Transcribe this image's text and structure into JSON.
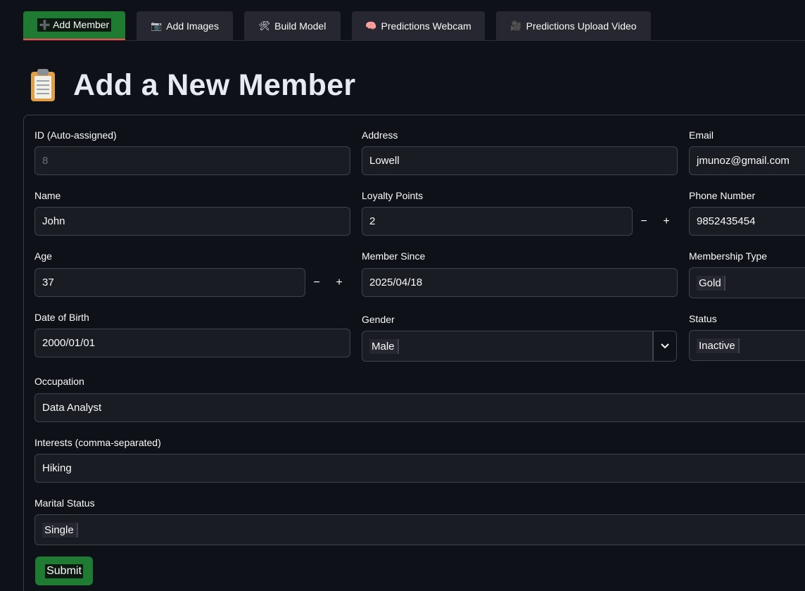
{
  "tabs": [
    {
      "icon": "➕",
      "label": "Add Member",
      "active": true
    },
    {
      "icon": "📷",
      "label": "Add Images"
    },
    {
      "icon": "🛠",
      "label": "Build Model"
    },
    {
      "icon": "🧠",
      "label": "Predictions Webcam"
    },
    {
      "icon": "🎥",
      "label": "Predictions Upload Video"
    }
  ],
  "page_title": "Add a New Member",
  "form": {
    "id": {
      "label": "ID (Auto-assigned)",
      "value": "8"
    },
    "address": {
      "label": "Address",
      "value": "Lowell"
    },
    "email": {
      "label": "Email",
      "value": "jmunoz@gmail.com"
    },
    "name": {
      "label": "Name",
      "value": "John"
    },
    "loyalty": {
      "label": "Loyalty Points",
      "value": "2"
    },
    "phone": {
      "label": "Phone Number",
      "value": "9852435454"
    },
    "age": {
      "label": "Age",
      "value": "37"
    },
    "member_since": {
      "label": "Member Since",
      "value": "2025/04/18"
    },
    "membership_type": {
      "label": "Membership Type",
      "value": "Gold"
    },
    "dob": {
      "label": "Date of Birth",
      "value": "2000/01/01"
    },
    "gender": {
      "label": "Gender",
      "value": "Male"
    },
    "status": {
      "label": "Status",
      "value": "Inactive"
    },
    "occupation": {
      "label": "Occupation",
      "value": "Data Analyst"
    },
    "interests": {
      "label": "Interests (comma-separated)",
      "value": "Hiking"
    },
    "marital": {
      "label": "Marital Status",
      "value": "Single"
    },
    "minus": "−",
    "plus": "+",
    "submit_label": "Submit"
  }
}
